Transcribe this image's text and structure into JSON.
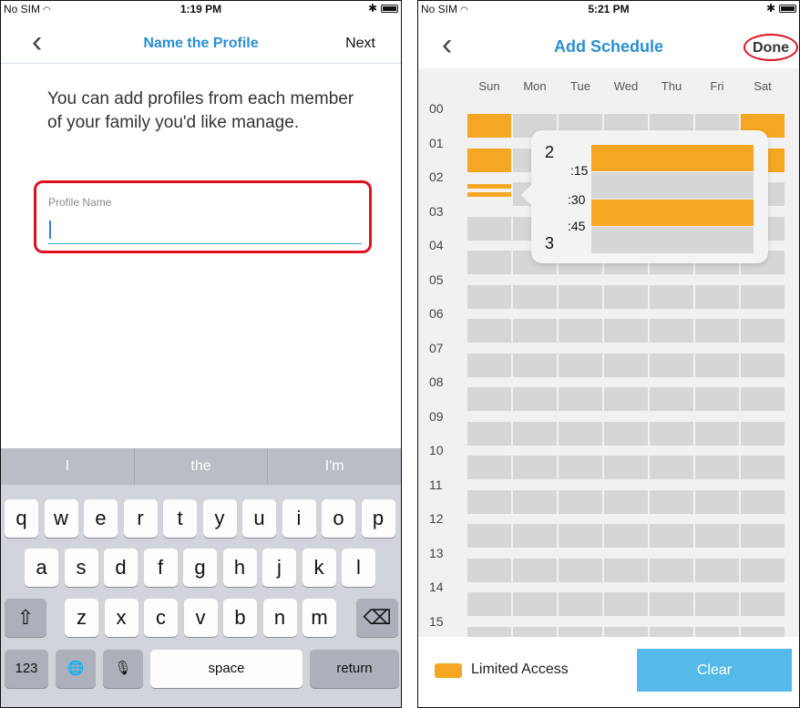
{
  "screen1": {
    "status": {
      "carrier": "No SIM",
      "time": "1:19 PM",
      "bluetooth": "✱"
    },
    "nav": {
      "back_icon": "chevron-left-icon",
      "title": "Name the Profile",
      "next": "Next"
    },
    "intro": "You can add profiles from each member of your family you'd like manage.",
    "field": {
      "label": "Profile Name",
      "value": ""
    },
    "keyboard": {
      "suggestions": [
        "I",
        "the",
        "I'm"
      ],
      "row1": [
        "q",
        "w",
        "e",
        "r",
        "t",
        "y",
        "u",
        "i",
        "o",
        "p"
      ],
      "row2": [
        "a",
        "s",
        "d",
        "f",
        "g",
        "h",
        "j",
        "k",
        "l"
      ],
      "row3": [
        "z",
        "x",
        "c",
        "v",
        "b",
        "n",
        "m"
      ],
      "shift": "⇧",
      "delete": "⌫",
      "numbers": "123",
      "globe": "🌐",
      "mic": "🎙",
      "space": "space",
      "return": "return"
    }
  },
  "screen2": {
    "status": {
      "carrier": "No SIM",
      "time": "5:21 PM",
      "bluetooth": "✱"
    },
    "nav": {
      "back_icon": "chevron-left-icon",
      "title": "Add Schedule",
      "done": "Done"
    },
    "days": [
      "Sun",
      "Mon",
      "Tue",
      "Wed",
      "Thu",
      "Fri",
      "Sat"
    ],
    "hours": [
      "00",
      "01",
      "02",
      "03",
      "04",
      "05",
      "06",
      "07",
      "08",
      "09",
      "10",
      "11",
      "12",
      "13",
      "14",
      "15"
    ],
    "popup": {
      "start_hour": "2",
      "end_hour": "3",
      "quarters": [
        ":15",
        ":30",
        ":45"
      ]
    },
    "legend": {
      "label": "Limited Access",
      "color": "#f5a623"
    },
    "clear": "Clear"
  }
}
